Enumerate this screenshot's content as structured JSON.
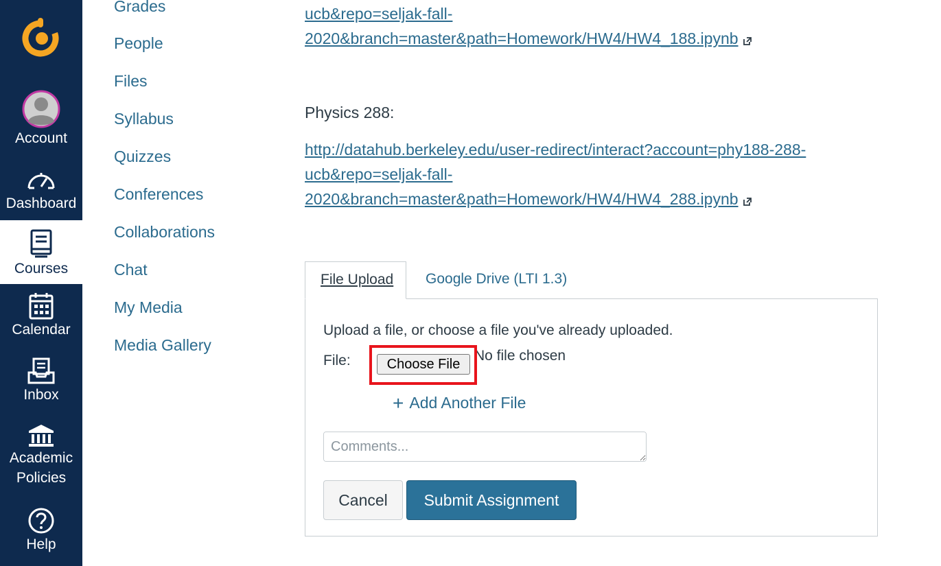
{
  "global_nav": {
    "items": [
      {
        "label": "Account",
        "icon": "avatar-icon"
      },
      {
        "label": "Dashboard",
        "icon": "speedometer-icon"
      },
      {
        "label": "Courses",
        "icon": "book-icon",
        "active": true
      },
      {
        "label": "Calendar",
        "icon": "calendar-icon"
      },
      {
        "label": "Inbox",
        "icon": "inbox-icon"
      },
      {
        "label_line1": "Academic",
        "label_line2": "Policies",
        "icon": "institution-icon"
      },
      {
        "label": "Help",
        "icon": "help-icon"
      }
    ],
    "colors": {
      "background": "#0e2a4e",
      "accent": "#f5a623",
      "avatar_ring": "#c13aa3"
    }
  },
  "course_nav": {
    "items": [
      "Grades",
      "People",
      "Files",
      "Syllabus",
      "Quizzes",
      "Conferences",
      "Collaborations",
      "Chat",
      "My Media",
      "Media Gallery"
    ]
  },
  "content": {
    "link_188": {
      "line1": "ucb&repo=seljak-fall-",
      "line2": "2020&branch=master&path=Homework/HW4/HW4_188.ipynb"
    },
    "physics288_heading": "Physics 288:",
    "link_288": {
      "line1": "http://datahub.berkeley.edu/user-redirect/interact?account=phy188-288-",
      "line2": "ucb&repo=seljak-fall-",
      "line3": "2020&branch=master&path=Homework/HW4/HW4_288.ipynb"
    }
  },
  "submission": {
    "tabs": [
      "File Upload",
      "Google Drive (LTI 1.3)"
    ],
    "instructions": "Upload a file, or choose a file you've already uploaded.",
    "file_label": "File:",
    "choose_file_label": "Choose File",
    "no_file_text": "No file chosen",
    "add_another_label": "Add Another File",
    "comments_placeholder": "Comments...",
    "cancel_label": "Cancel",
    "submit_label": "Submit Assignment",
    "colors": {
      "link": "#2b6b8e",
      "submit": "#2b7299",
      "highlight": "#e8141c"
    }
  }
}
